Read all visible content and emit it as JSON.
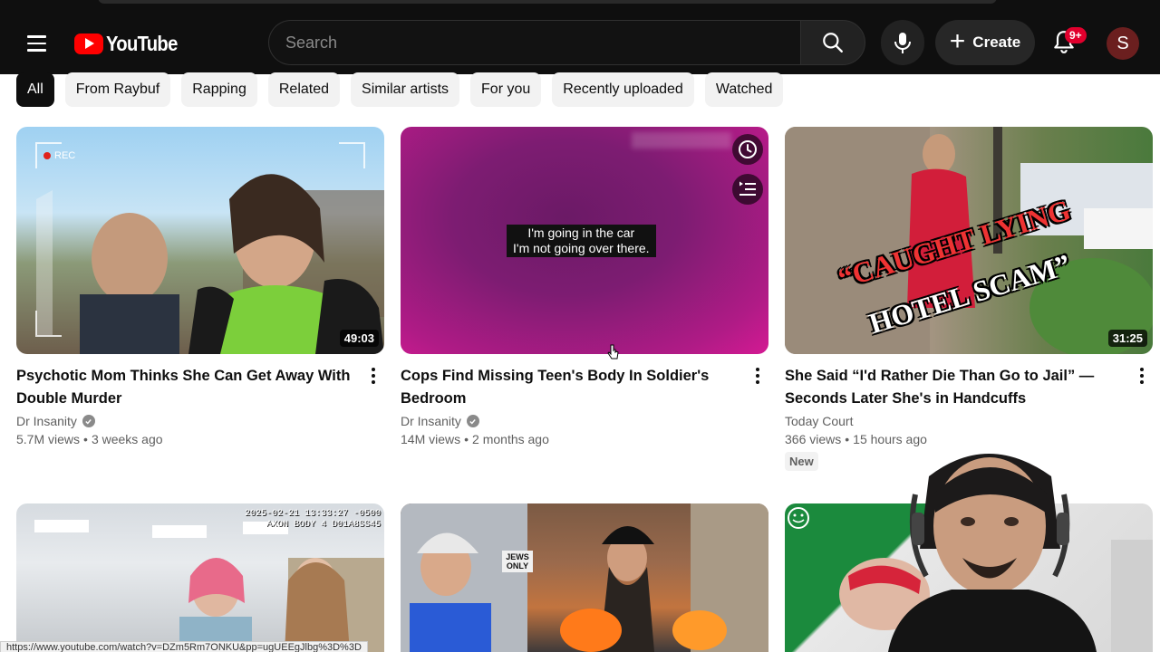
{
  "masthead": {
    "logo_text": "YouTube",
    "search_placeholder": "Search",
    "create_label": "Create",
    "notification_count": "9+",
    "avatar_initial": "S"
  },
  "chips": [
    "All",
    "From Raybuf",
    "Rapping",
    "Related",
    "Similar artists",
    "For you",
    "Recently uploaded",
    "Watched"
  ],
  "videos": [
    {
      "title": "Psychotic Mom Thinks She Can Get Away With Double Murder",
      "channel": "Dr Insanity",
      "verified": true,
      "views": "5.7M views",
      "age": "3 weeks ago",
      "duration": "49:03",
      "thumb_text": "REC"
    },
    {
      "title": "Cops Find Missing Teen's Body In Soldier's Bedroom",
      "channel": "Dr Insanity",
      "verified": true,
      "views": "14M views",
      "age": "2 months ago",
      "subtitle_line1": "I'm going in the car",
      "subtitle_line2": "I'm not going over there."
    },
    {
      "title": "She Said “I'd Rather Die Than Go to Jail” — Seconds Later She's in Handcuffs",
      "channel": "Today Court",
      "verified": false,
      "views": "366 views",
      "age": "15 hours ago",
      "duration": "31:25",
      "badge": "New",
      "thumb_line1": "“CAUGHT LYING",
      "thumb_line2": "HOTEL SCAM”"
    },
    {
      "thumb_stamp_line1": "2025-02-21 13:33:27 -0500",
      "thumb_stamp_line2": "AXON BODY 4 D01A8SS45"
    },
    {
      "thumb_signs": "JEWS ONLY"
    },
    {}
  ],
  "status_bar_url": "https://www.youtube.com/watch?v=DZm5Rm7ONKU&pp=ugUEEgJlbg%3D%3D",
  "colors": {
    "masthead_bg": "#0f0f0f",
    "brand_red": "#ff0000",
    "notification_badge": "#e1002d",
    "chip_active_bg": "#0f0f0f",
    "chip_bg": "#f2f2f2"
  }
}
